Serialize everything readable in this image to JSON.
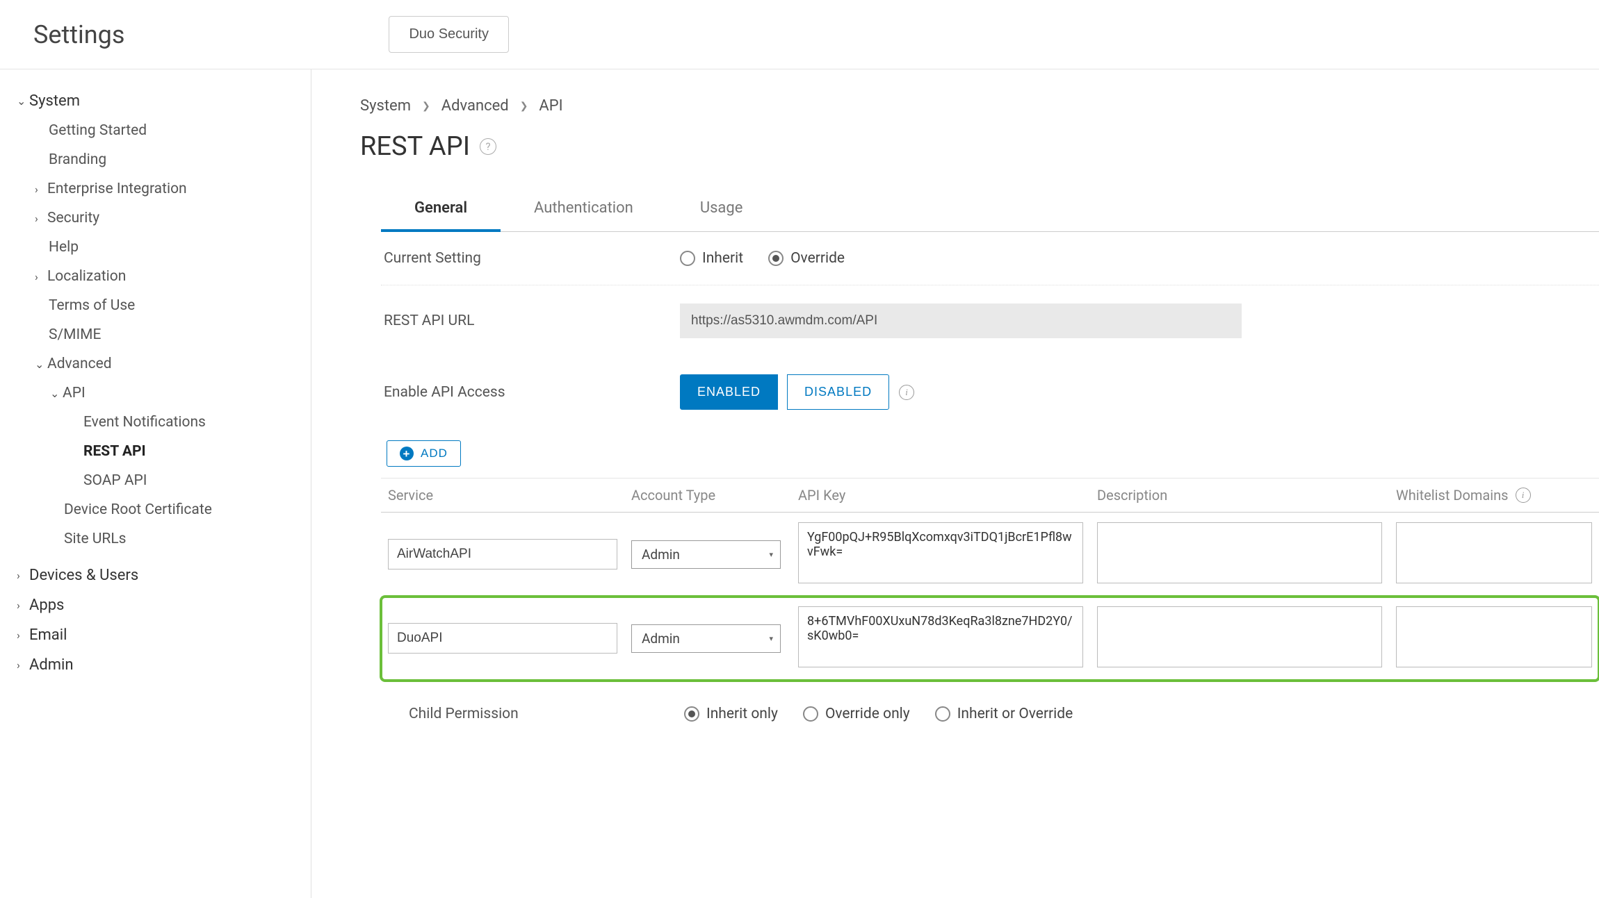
{
  "header": {
    "title": "Settings",
    "button": "Duo Security"
  },
  "sidebar": {
    "system": "System",
    "getting_started": "Getting Started",
    "branding": "Branding",
    "enterprise_integration": "Enterprise Integration",
    "security": "Security",
    "help": "Help",
    "localization": "Localization",
    "terms_of_use": "Terms of Use",
    "smime": "S/MIME",
    "advanced": "Advanced",
    "api": "API",
    "event_notifications": "Event Notifications",
    "rest_api": "REST API",
    "soap_api": "SOAP API",
    "device_root_cert": "Device Root Certificate",
    "site_urls": "Site URLs",
    "devices_users": "Devices & Users",
    "apps": "Apps",
    "email": "Email",
    "admin": "Admin"
  },
  "breadcrumb": {
    "a": "System",
    "b": "Advanced",
    "c": "API"
  },
  "page_title": "REST API",
  "tabs": {
    "general": "General",
    "authentication": "Authentication",
    "usage": "Usage"
  },
  "form": {
    "current_setting": "Current Setting",
    "inherit": "Inherit",
    "override": "Override",
    "rest_api_url_label": "REST API URL",
    "rest_api_url_value": "https://as5310.awmdm.com/API",
    "enable_api_access": "Enable API Access",
    "enabled": "ENABLED",
    "disabled": "DISABLED",
    "add": "ADD",
    "child_permission": "Child Permission",
    "inherit_only": "Inherit only",
    "override_only": "Override only",
    "inherit_or_override": "Inherit or Override"
  },
  "table": {
    "headers": {
      "service": "Service",
      "account_type": "Account Type",
      "api_key": "API Key",
      "description": "Description",
      "whitelist_domains": "Whitelist Domains"
    },
    "rows": [
      {
        "service": "AirWatchAPI",
        "account_type": "Admin",
        "api_key": "YgF00pQJ+R95BlqXcomxqv3iTDQ1jBcrE1Pfl8wvFwk=",
        "description": "",
        "whitelist": ""
      },
      {
        "service": "DuoAPI",
        "account_type": "Admin",
        "api_key": "8+6TMVhF00XUxuN78d3KeqRa3l8zne7HD2Y0/sK0wb0=",
        "description": "",
        "whitelist": ""
      }
    ]
  }
}
